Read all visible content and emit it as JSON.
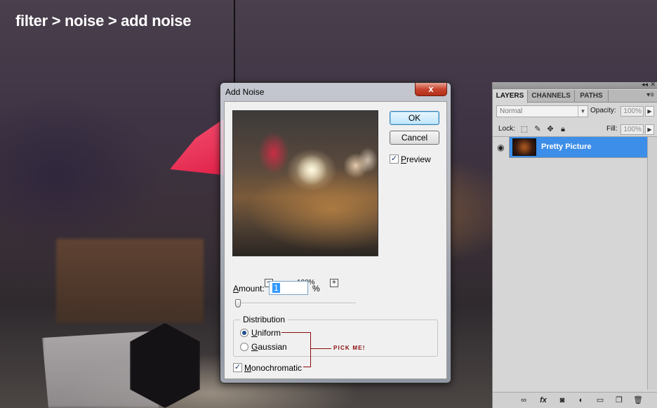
{
  "headline": "filter > noise > add noise",
  "dialog": {
    "title": "Add Noise",
    "close_glyph": "x",
    "zoom_level": "100%",
    "zoom_out_glyph": "−",
    "zoom_in_glyph": "+",
    "ok_label": "OK",
    "cancel_label": "Cancel",
    "preview": {
      "key": "P",
      "rest": "review",
      "checked": true
    },
    "amount": {
      "key": "A",
      "rest": "mount:",
      "value": "1",
      "unit": "%"
    },
    "slider": {
      "min": 0,
      "max": 400,
      "value": 1
    },
    "distribution": {
      "title": "Distribution",
      "options": [
        {
          "key": "U",
          "rest": "niform",
          "selected": true
        },
        {
          "key": "G",
          "rest": "aussian",
          "selected": false
        }
      ]
    },
    "monochromatic": {
      "key": "M",
      "rest": "onochromatic",
      "checked": true
    },
    "annotation": "PICK ME!"
  },
  "layers_panel": {
    "tabs": [
      "LAYERS",
      "CHANNELS",
      "PATHS"
    ],
    "active_tab": "LAYERS",
    "blend_mode": "Normal",
    "opacity_label": "Opacity:",
    "opacity_value": "100%",
    "lock_label": "Lock:",
    "fill_label": "Fill:",
    "fill_value": "100%",
    "layer_name": "Pretty Picture",
    "footer_icons": [
      "link-layers-icon",
      "fx-icon",
      "mask-icon",
      "adjustment-icon",
      "group-folder-icon",
      "new-layer-icon",
      "trash-icon"
    ]
  },
  "colors": {
    "annotation": "#8a0b0b",
    "selected_layer": "#3d8ee8",
    "headline": "#ffffff"
  }
}
